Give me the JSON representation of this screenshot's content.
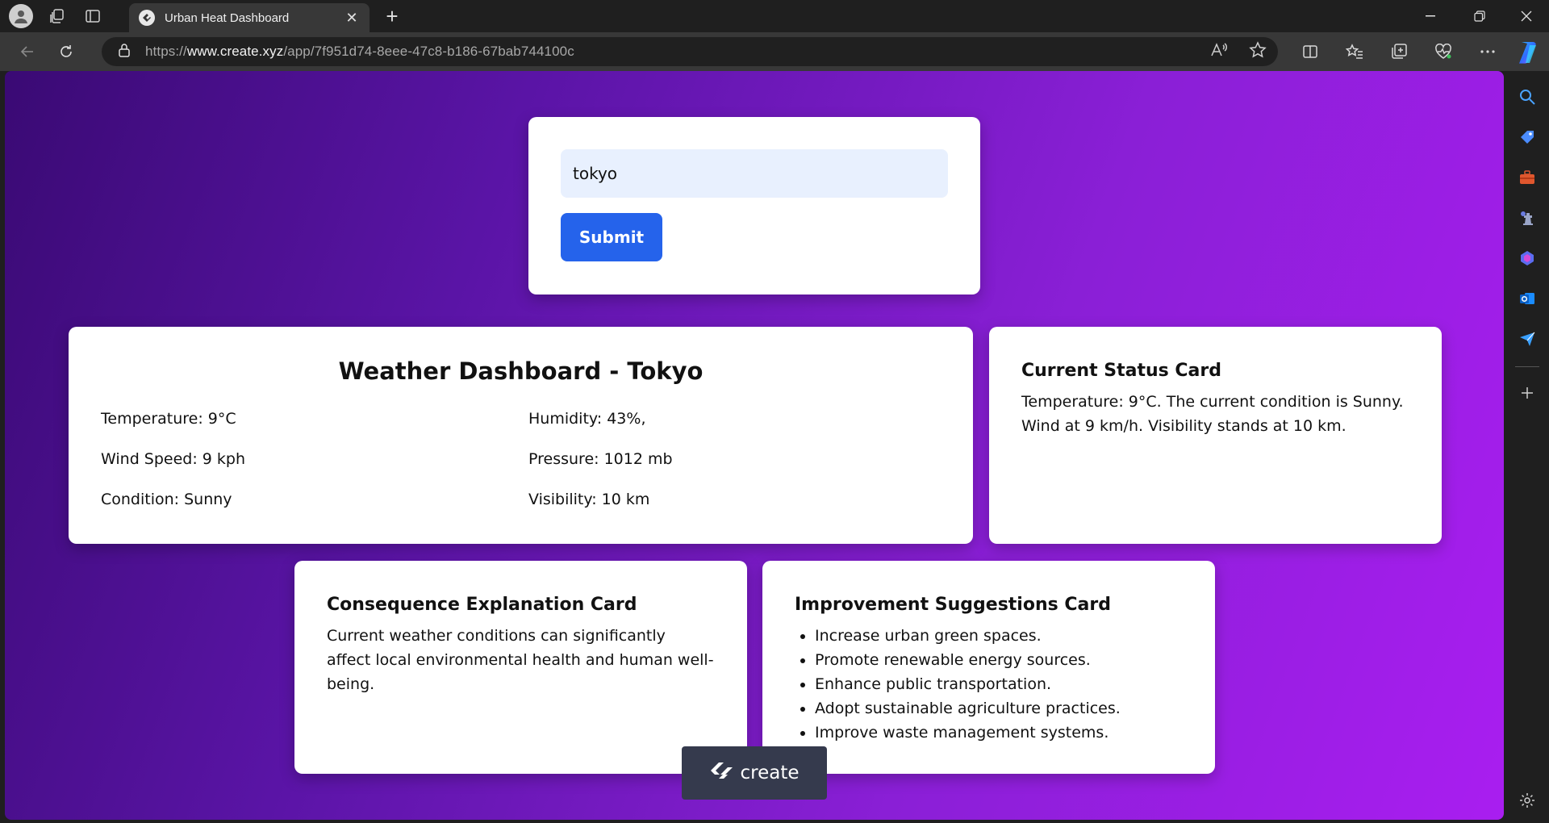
{
  "browser": {
    "tab_title": "Urban Heat Dashboard",
    "new_tab_symbol": "+",
    "url_prefix": "https://",
    "url_domain": "www.create.xyz",
    "url_path": "/app/7f951d74-8eee-47c8-b186-67bab744100c"
  },
  "search": {
    "input_value": "tokyo",
    "submit_label": "Submit"
  },
  "weather": {
    "title": "Weather Dashboard - Tokyo",
    "temperature": "Temperature: 9°C",
    "wind_speed": "Wind Speed: 9 kph",
    "condition": "Condition: Sunny",
    "humidity": "Humidity: 43%,",
    "pressure": "Pressure: 1012 mb",
    "visibility": "Visibility: 10 km"
  },
  "status_card": {
    "title": "Current Status Card",
    "text": "Temperature: 9°C. The current condition is Sunny. Wind at 9 km/h. Visibility stands at 10 km."
  },
  "consequence_card": {
    "title": "Consequence Explanation Card",
    "text": "Current weather conditions can significantly affect local environmental health and human well-being."
  },
  "improvement_card": {
    "title": "Improvement Suggestions Card",
    "items": [
      "Increase urban green spaces.",
      "Promote renewable energy sources.",
      "Enhance public transportation.",
      "Adopt sustainable agriculture practices.",
      "Improve waste management systems."
    ]
  },
  "badge": {
    "label": "create"
  },
  "colors": {
    "page_gradient_start": "#3a0a74",
    "page_gradient_end": "#a91ef0",
    "submit_blue": "#2563eb",
    "input_bg": "#e8f0fe",
    "badge_bg": "#353a4d"
  }
}
